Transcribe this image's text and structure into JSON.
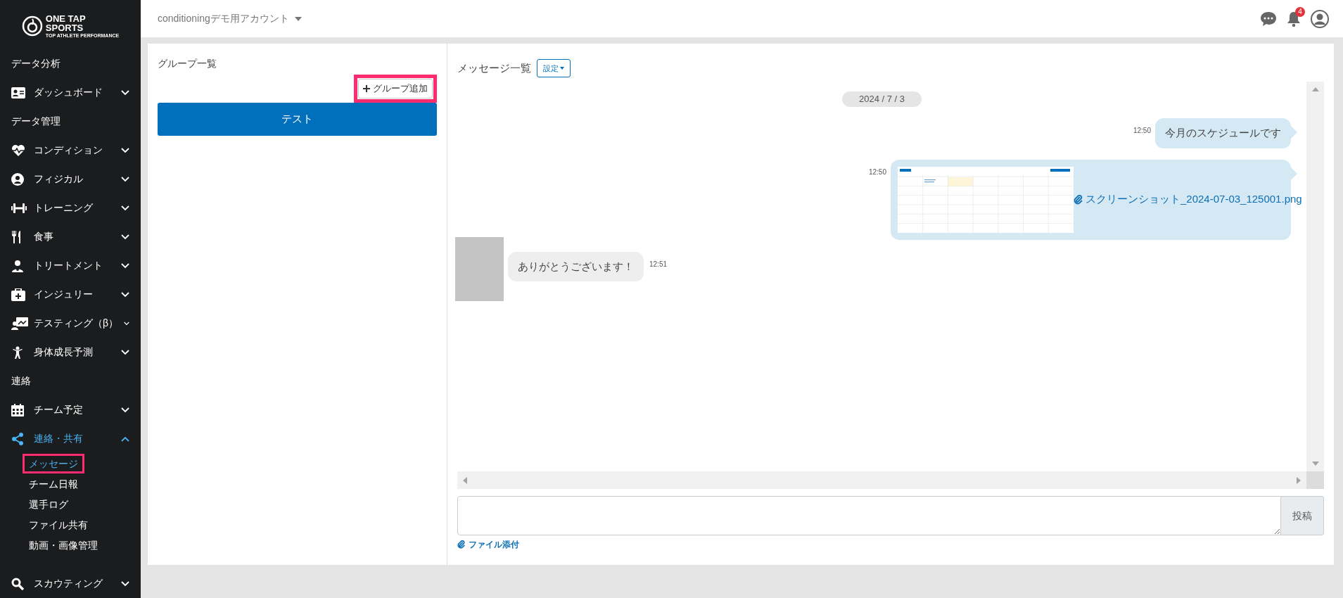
{
  "logo": {
    "title_line1": "ONE TAP",
    "title_line2": "SPORTS",
    "tagline": "TOP ATHLETE PERFORMANCE"
  },
  "header": {
    "account": "conditioningデモ用アカウント",
    "notification_count": "4"
  },
  "sidebar": {
    "items": [
      {
        "kind": "heading",
        "label": "データ分析"
      },
      {
        "kind": "menu",
        "label": "ダッシュボード",
        "expanded": false
      },
      {
        "kind": "heading",
        "label": "データ管理"
      },
      {
        "kind": "menu",
        "label": "コンディション",
        "expanded": false
      },
      {
        "kind": "menu",
        "label": "フィジカル",
        "expanded": false
      },
      {
        "kind": "menu",
        "label": "トレーニング",
        "expanded": false
      },
      {
        "kind": "menu",
        "label": "食事",
        "expanded": false
      },
      {
        "kind": "menu",
        "label": "トリートメント",
        "expanded": false
      },
      {
        "kind": "menu",
        "label": "インジュリー",
        "expanded": false
      },
      {
        "kind": "menu",
        "label": "テスティング（β）",
        "expanded": false
      },
      {
        "kind": "menu",
        "label": "身体成長予測",
        "expanded": false
      },
      {
        "kind": "heading",
        "label": "連絡"
      },
      {
        "kind": "menu",
        "label": "チーム予定",
        "expanded": false
      },
      {
        "kind": "menu",
        "label": "連絡・共有",
        "expanded": true,
        "children": [
          {
            "label": "メッセージ",
            "selected": true,
            "highlighted": true
          },
          {
            "label": "チーム日報",
            "selected": false,
            "highlighted": false
          },
          {
            "label": "選手ログ",
            "selected": false,
            "highlighted": false
          },
          {
            "label": "ファイル共有",
            "selected": false,
            "highlighted": false
          },
          {
            "label": "動画・画像管理",
            "selected": false,
            "highlighted": false
          }
        ]
      },
      {
        "kind": "menu",
        "label": "スカウティング",
        "expanded": false
      }
    ]
  },
  "groups": {
    "title": "グループ一覧",
    "add_button": {
      "label": "グループ追加",
      "highlighted": true
    },
    "items": [
      {
        "label": "テスト",
        "selected": true
      }
    ]
  },
  "messages": {
    "title": "メッセージ一覧",
    "settings_button": "設定",
    "date": "2024 / 7 / 3",
    "items": [
      {
        "kind": "sent_text",
        "text": "今月のスケジュールです",
        "time": "12:50"
      },
      {
        "kind": "sent_attachment",
        "file": "スクリーンショット_2024-07-03_125001.png",
        "time": "12:50"
      },
      {
        "kind": "received_text",
        "text": "ありがとうございます！",
        "time": "12:51"
      }
    ]
  },
  "composer": {
    "post_button": "投稿",
    "attach_link": "ファイル添付"
  }
}
